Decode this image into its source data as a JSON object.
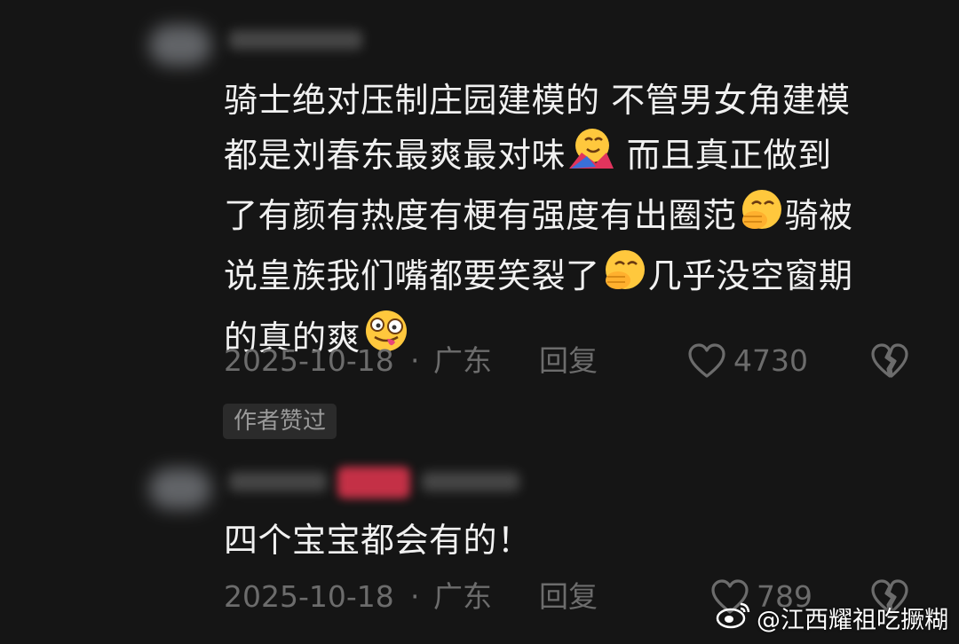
{
  "comments": [
    {
      "text_parts": [
        "骑士绝对压制庄园建模的 不管男女角建模\n都是刘春东最爽最对味",
        " 而且真正做到\n了有颜有热度有梗有强度有出圈范",
        "骑被\n说皇族我们嘴都要笑裂了",
        "几乎没空窗期\n的真的爽"
      ],
      "emojis": [
        "hugging-face",
        "face-with-hand-over-mouth",
        "face-with-hand-over-mouth",
        "zany-face"
      ],
      "date": "2025-10-18",
      "separator": "·",
      "region": "广东",
      "reply_label": "回复",
      "like_count": "4730",
      "author_badge": "作者赞过"
    },
    {
      "text_parts": [
        "四个宝宝都会有的！"
      ],
      "date": "2025-10-18",
      "separator": "·",
      "region": "广东",
      "reply_label": "回复",
      "like_count": "789"
    }
  ],
  "watermark": {
    "text": "@江西耀祖吃撅糊",
    "icon": "weibo-icon"
  }
}
